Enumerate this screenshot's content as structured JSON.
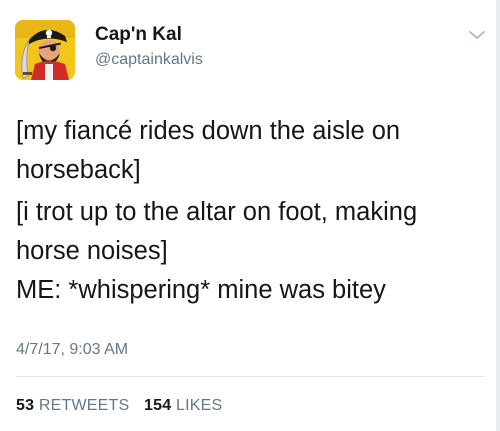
{
  "author": {
    "display_name": "Cap'n Kal",
    "handle": "@captainkalvis",
    "avatar_icon": "pirate-avatar-icon"
  },
  "tweet": {
    "lines": [
      "[my fiancé rides down the aisle on horseback]",
      "[i trot up to the altar on foot, making horse noises]",
      "ME: *whispering* mine was bitey"
    ],
    "timestamp": "4/7/17, 9:03 AM"
  },
  "stats": {
    "retweets_count": "53",
    "retweets_label": "Retweets",
    "likes_count": "154",
    "likes_label": "Likes"
  },
  "colors": {
    "text": "#14171a",
    "secondary": "#657786",
    "divider": "#e1e8ed"
  }
}
